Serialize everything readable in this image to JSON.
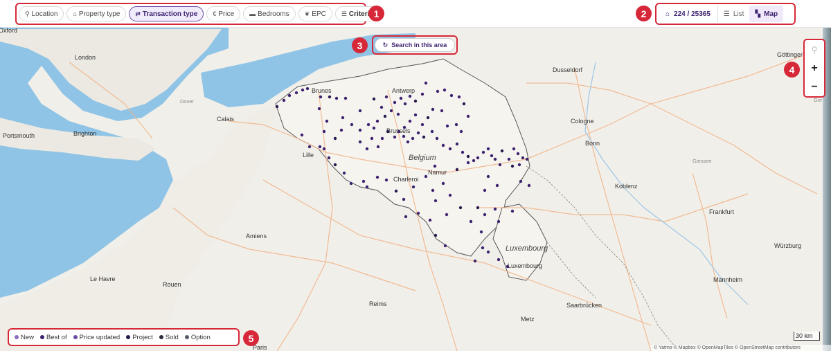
{
  "filters": [
    {
      "label": "Location",
      "icon": "pin-icon",
      "glyph": "⚲",
      "active": false
    },
    {
      "label": "Property type",
      "icon": "house-icon",
      "glyph": "⌂",
      "active": false
    },
    {
      "label": "Transaction type",
      "icon": "swap-icon",
      "glyph": "⇄",
      "active": true
    },
    {
      "label": "Price",
      "icon": "euro-icon",
      "glyph": "€",
      "active": false
    },
    {
      "label": "Bedrooms",
      "icon": "bed-icon",
      "glyph": "▬",
      "active": false
    },
    {
      "label": "EPC",
      "icon": "leaf-icon",
      "glyph": "❦",
      "active": false
    },
    {
      "label": "Criteria",
      "icon": "sliders-icon",
      "glyph": "☰",
      "active": false
    }
  ],
  "badges": [
    "1",
    "2",
    "3",
    "4",
    "5"
  ],
  "results": {
    "count_text": "224 / 25365",
    "icon": "house-icon",
    "glyph": "⌂"
  },
  "views": {
    "list_label": "List",
    "map_label": "Map",
    "active": "Map"
  },
  "search_area": {
    "label": "Search in this area",
    "icon": "refresh-icon",
    "glyph": "↻"
  },
  "zoom": {
    "locate_glyph": "⚲",
    "plus": "+",
    "minus": "−"
  },
  "legend": [
    {
      "label": "New",
      "color": "#8a6cc0"
    },
    {
      "label": "Best of",
      "color": "#3d2270"
    },
    {
      "label": "Price updated",
      "color": "#6b4aa8"
    },
    {
      "label": "Project",
      "color": "#2a1850"
    },
    {
      "label": "Sold",
      "color": "#2b2b40"
    },
    {
      "label": "Option",
      "color": "#555a66"
    }
  ],
  "scale": "30 km",
  "attribution": "© Yatmo © Mapbox © OpenMapTiles © OpenStreetMap contributors",
  "map": {
    "country_labels": {
      "belgium": "Belgium",
      "luxembourg": "Luxembourg"
    },
    "cities": {
      "oxford": "Oxford",
      "london": "London",
      "dover": "Dover",
      "brighton": "Brighton",
      "portsmouth": "Portsmouth",
      "calais": "Calais",
      "lille": "Lille",
      "brunes": "Brunes",
      "antwerp": "Antwerp",
      "brussels": "Brussels",
      "namur": "Namur",
      "charleroi": "Charleroi",
      "amiens": "Amiens",
      "le_havre": "Le Havre",
      "rouen": "Rouen",
      "reims": "Reims",
      "paris": "Paris",
      "metz": "Metz",
      "luxembourg_city": "Luxembourg",
      "dusseldorf": "Dusseldorf",
      "cologne": "Cologne",
      "bonn": "Bonn",
      "giessen": "Giessen",
      "koblenz": "Koblenz",
      "frankfurt": "Frankfurt",
      "mannheim": "Mannheim",
      "saarbrucken": "Saarbrücken",
      "wurzburg": "Würzburg",
      "gottingen": "Göttinger",
      "germ": "Germ"
    }
  }
}
